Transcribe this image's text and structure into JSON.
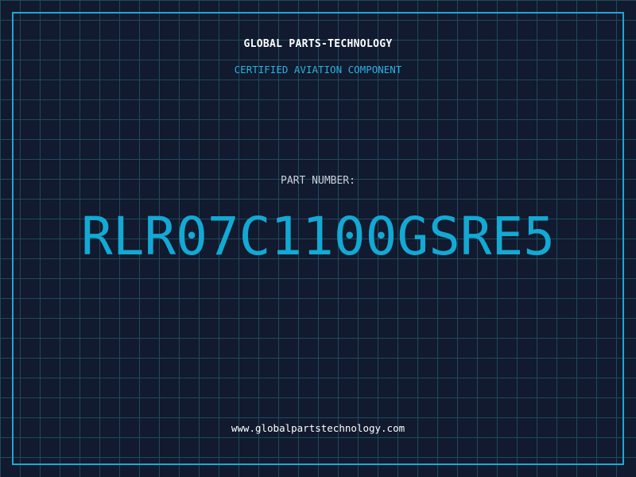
{
  "header": {
    "company": "GLOBAL PARTS-TECHNOLOGY",
    "subtitle": "CERTIFIED AVIATION COMPONENT"
  },
  "part": {
    "label": "PART NUMBER:",
    "number": "RLR07C1100GSRE5"
  },
  "footer": {
    "url": "www.globalpartstechnology.com"
  },
  "colors": {
    "background": "#111a2e",
    "grid": "#1f4a5e",
    "accent": "#13a9d4",
    "frame": "#1ea7d6",
    "text_primary": "#ffffff",
    "text_muted": "#c9ced8"
  }
}
